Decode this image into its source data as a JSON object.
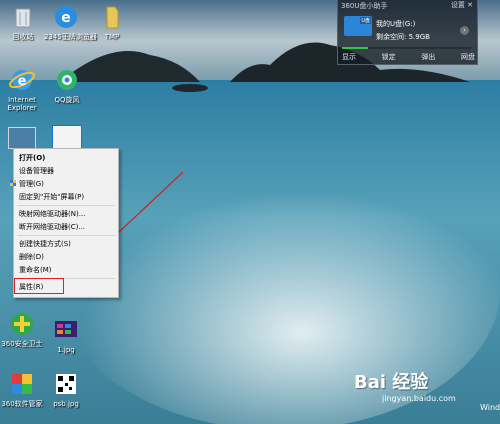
{
  "desktop": {
    "icons": [
      {
        "label": "回收站",
        "icon": "recycle-bin-icon"
      },
      {
        "label": "2345王牌浏览器",
        "icon": "ie-e-icon"
      },
      {
        "label": "TMP",
        "icon": "folder-icon"
      },
      {
        "label": "Internet Explorer",
        "icon": "internet-explorer-icon"
      },
      {
        "label": "QQ旋风",
        "icon": "qq-whirlwind-icon"
      },
      {
        "label": "360安全卫士",
        "icon": "360-security-icon"
      },
      {
        "label": "1.jpg",
        "icon": "image-file-icon"
      },
      {
        "label": "360软件管家",
        "icon": "360-software-icon"
      },
      {
        "label": "psb.jpg",
        "icon": "qr-code-image-icon"
      }
    ]
  },
  "widget": {
    "title": "360U盘小助手",
    "controls": "设置  ✕",
    "drive_tag": "U盘",
    "drive_name": "我的U盘(G:)",
    "free_space": "剩余空间: 5.9GB",
    "usage_fraction": 0.2,
    "actions": [
      "显示",
      "锁定",
      "弹出",
      "网盘"
    ]
  },
  "context_menu": {
    "items": [
      {
        "label": "打开(O)",
        "bold": true
      },
      {
        "label": "设备管理器"
      },
      {
        "label": "管理(G)",
        "shield": true
      },
      {
        "label": "固定到\"开始\"屏幕(P)"
      },
      {
        "label": "映射网络驱动器(N)..."
      },
      {
        "label": "断开网络驱动器(C)..."
      },
      {
        "label": "创建快捷方式(S)"
      },
      {
        "label": "删除(D)"
      },
      {
        "label": "重命名(M)"
      },
      {
        "label": "属性(R)"
      }
    ]
  },
  "watermark": {
    "logo": "Bai 经验",
    "url": "jingyan.baidu.com",
    "os_text": "Windo"
  },
  "colors": {
    "highlight": "#e02020",
    "arrow": "#d02020",
    "sea": "#3f7f98"
  }
}
